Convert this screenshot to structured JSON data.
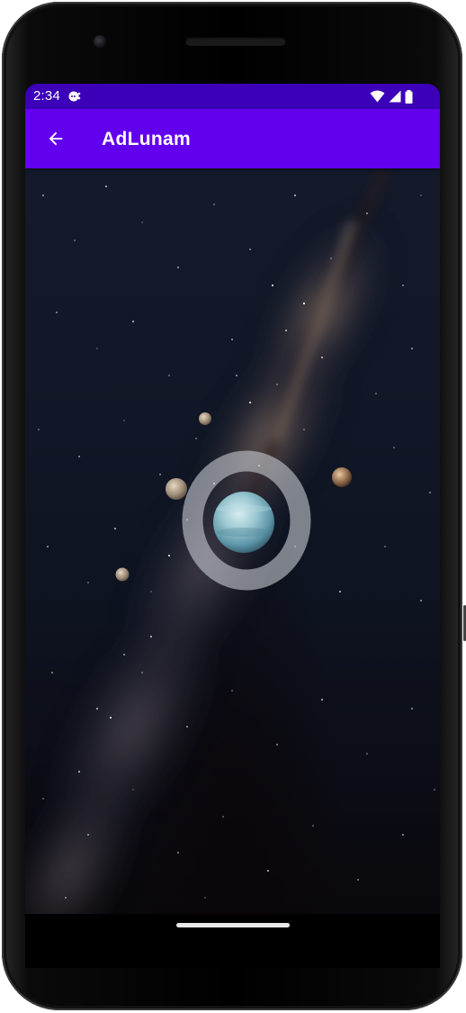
{
  "status_bar": {
    "time": "2:34",
    "icons": [
      "notification-icon",
      "wifi-icon",
      "cellular-signal-icon",
      "battery-icon"
    ]
  },
  "app_bar": {
    "back_icon": "arrow-back-icon",
    "title": "AdLunam"
  },
  "scene": {
    "description_icons": [
      "planet-icon",
      "planet-ring-icon",
      "moon-icon"
    ]
  },
  "colors": {
    "status_bar": "#3b00b8",
    "app_bar": "#6200ee",
    "planet": "#7fb3c2",
    "ring": "#b8bcc4"
  }
}
